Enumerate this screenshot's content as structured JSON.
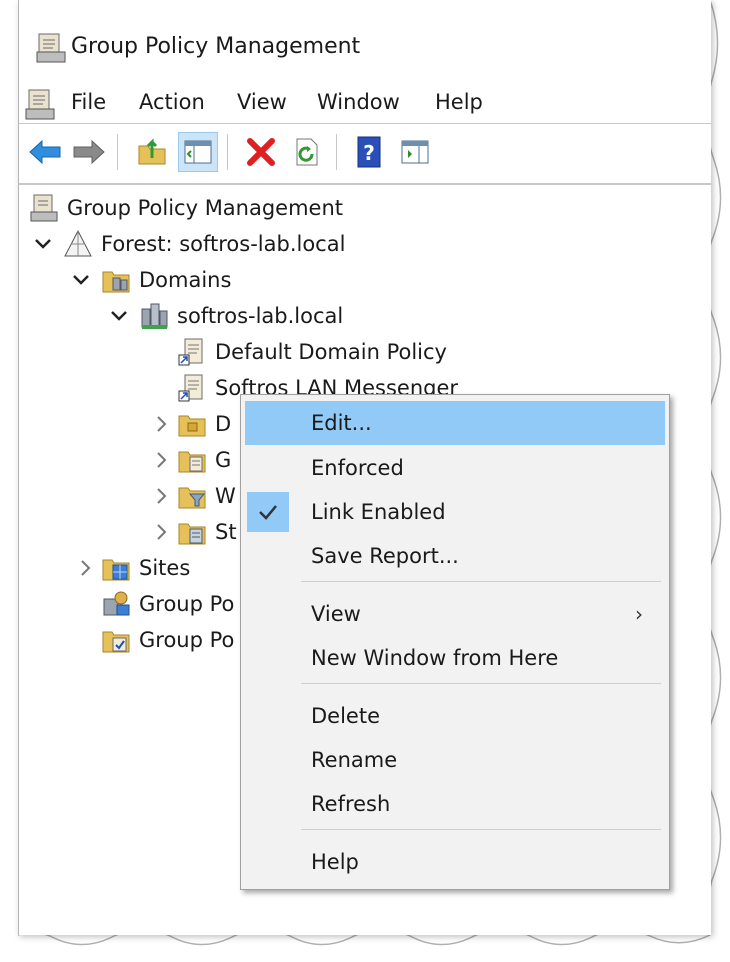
{
  "window": {
    "title": "Group Policy Management"
  },
  "menubar": {
    "items": [
      "File",
      "Action",
      "View",
      "Window",
      "Help"
    ]
  },
  "toolbar": {
    "buttons": [
      {
        "name": "back-arrow-icon"
      },
      {
        "name": "forward-arrow-icon"
      },
      {
        "name": "up-folder-icon"
      },
      {
        "name": "show-hide-tree-icon",
        "active": true
      },
      {
        "name": "delete-x-icon"
      },
      {
        "name": "refresh-icon"
      },
      {
        "name": "help-icon"
      },
      {
        "name": "action-pane-icon"
      }
    ]
  },
  "tree": {
    "root": "Group Policy Management",
    "forest": "Forest: softros-lab.local",
    "domains": "Domains",
    "domain": "softros-lab.local",
    "gpo_default": "Default Domain Policy",
    "gpo_selected": "Softros LAN Messenger",
    "child_1": "D",
    "child_2": "G",
    "child_3": "W",
    "child_4": "St",
    "sites": "Sites",
    "group_1": "Group Po",
    "group_2": "Group Po"
  },
  "context_menu": {
    "edit": "Edit...",
    "enforced": "Enforced",
    "link_enabled": "Link Enabled",
    "save_report": "Save Report...",
    "view": "View",
    "new_window": "New Window from Here",
    "delete": "Delete",
    "rename": "Rename",
    "refresh": "Refresh",
    "help": "Help"
  },
  "colors": {
    "highlight": "#91c9f7",
    "selection": "#cce8ff",
    "menu_bg": "#f2f2f2"
  }
}
